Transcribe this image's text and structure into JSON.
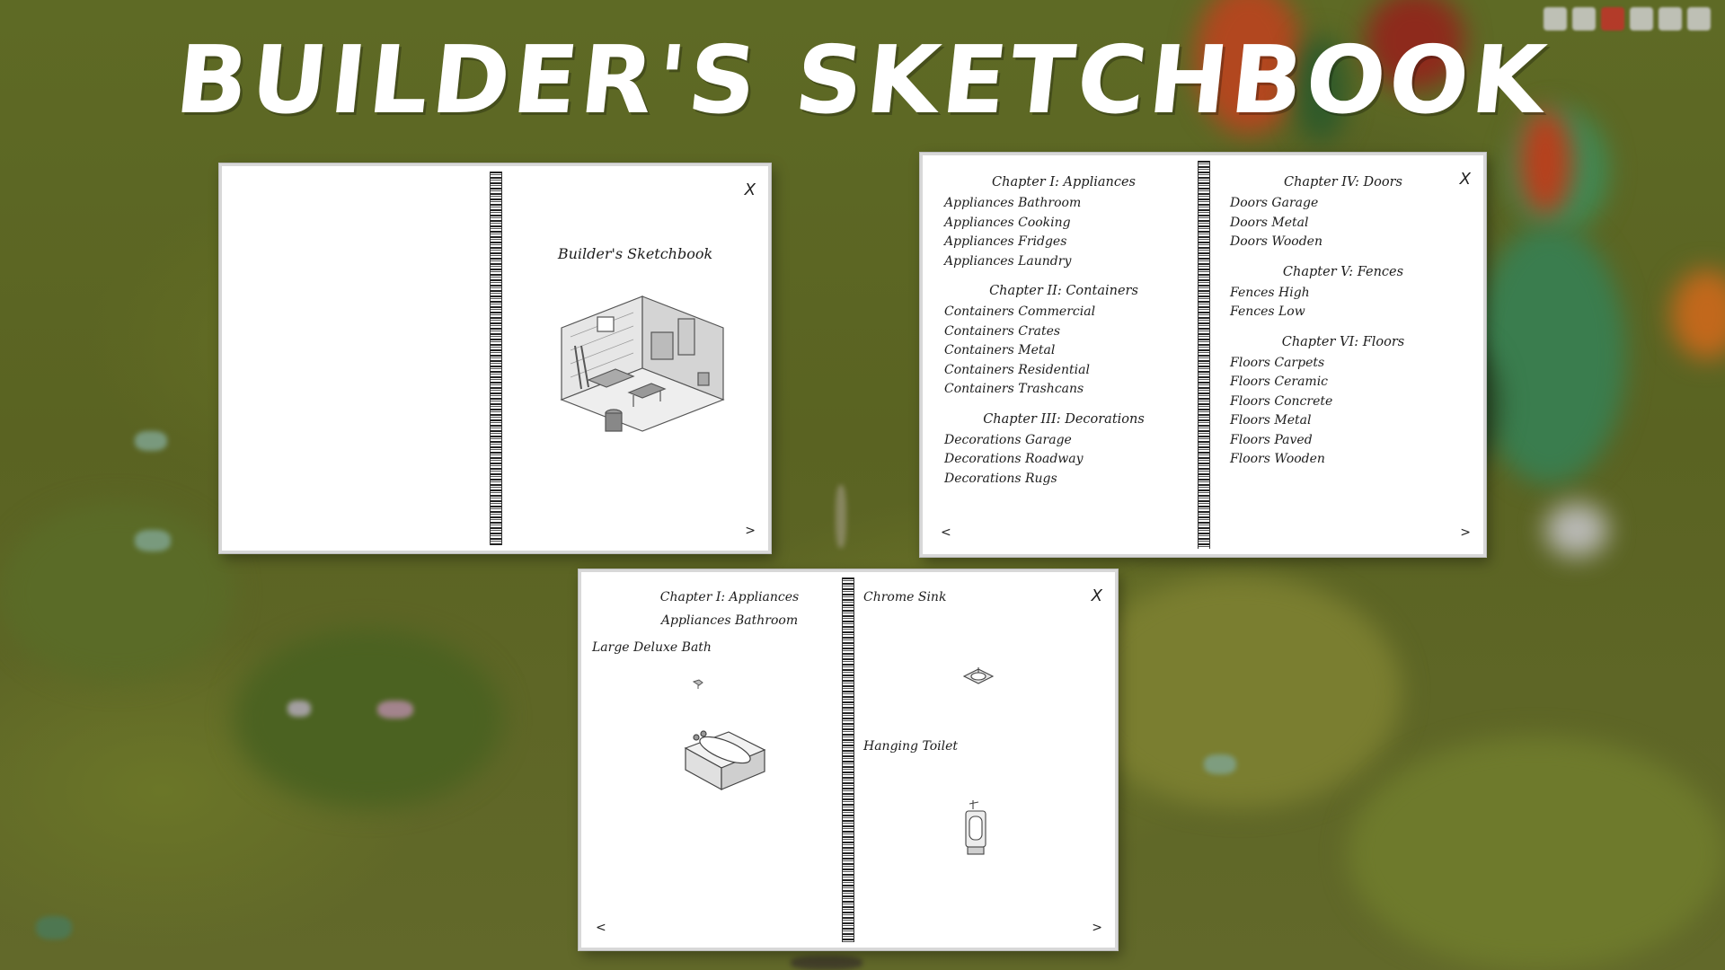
{
  "title": "BUILDER'S SKETCHBOOK",
  "speed_controls": [
    "pause-icon",
    "play-icon",
    "fast-forward-icon",
    "faster-icon",
    "fastest-icon",
    "clock-icon"
  ],
  "colors": {
    "active_speed": "#c2322a",
    "paper": "#ffffff",
    "ink": "#1c1c1c"
  },
  "cover_book": {
    "cover_title": "Builder's Sketchbook",
    "close": "X",
    "next": ">"
  },
  "toc_book": {
    "close": "X",
    "prev": "<",
    "next": ">",
    "left_chapters": [
      {
        "title": "Chapter I: Appliances",
        "items": [
          "Appliances Bathroom",
          "Appliances Cooking",
          "Appliances Fridges",
          "Appliances Laundry"
        ]
      },
      {
        "title": "Chapter II: Containers",
        "items": [
          "Containers Commercial",
          "Containers Crates",
          "Containers Metal",
          "Containers Residential",
          "Containers Trashcans"
        ]
      },
      {
        "title": "Chapter III: Decorations",
        "items": [
          "Decorations Garage",
          "Decorations Roadway",
          "Decorations Rugs"
        ]
      }
    ],
    "right_chapters": [
      {
        "title": "Chapter IV: Doors",
        "items": [
          "Doors Garage",
          "Doors Metal",
          "Doors Wooden"
        ]
      },
      {
        "title": "Chapter V: Fences",
        "items": [
          "Fences High",
          "Fences Low"
        ]
      },
      {
        "title": "Chapter VI: Floors",
        "items": [
          "Floors Carpets",
          "Floors Ceramic",
          "Floors Concrete",
          "Floors Metal",
          "Floors Paved",
          "Floors Wooden"
        ]
      }
    ]
  },
  "detail_book": {
    "chapter": "Chapter I: Appliances",
    "section": "Appliances Bathroom",
    "close": "X",
    "prev": "<",
    "next": ">",
    "left_items": [
      "Large Deluxe Bath"
    ],
    "right_items": [
      "Chrome Sink",
      "Hanging Toilet"
    ]
  }
}
